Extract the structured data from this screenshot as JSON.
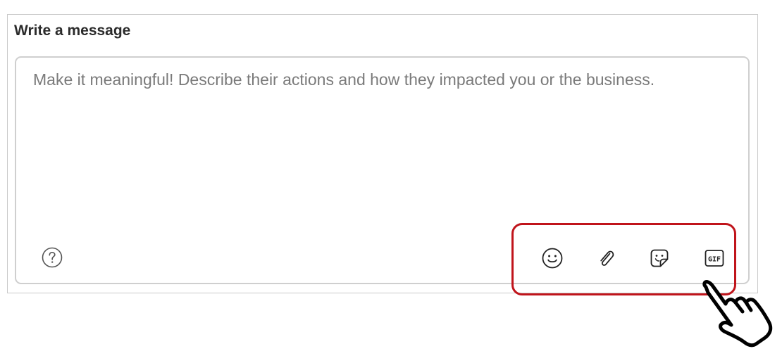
{
  "composer": {
    "title": "Write a message",
    "placeholder": "Make it meaningful! Describe their actions and how they impacted you or the business."
  },
  "toolbar": {
    "help_icon": "help-circle-icon",
    "emoji_icon": "smiley-icon",
    "attach_icon": "paperclip-icon",
    "sticker_icon": "sticker-icon",
    "gif_label": "GIF"
  },
  "annotation": {
    "highlight_color": "#c0141b",
    "pointer_icon": "pointing-hand-icon"
  }
}
